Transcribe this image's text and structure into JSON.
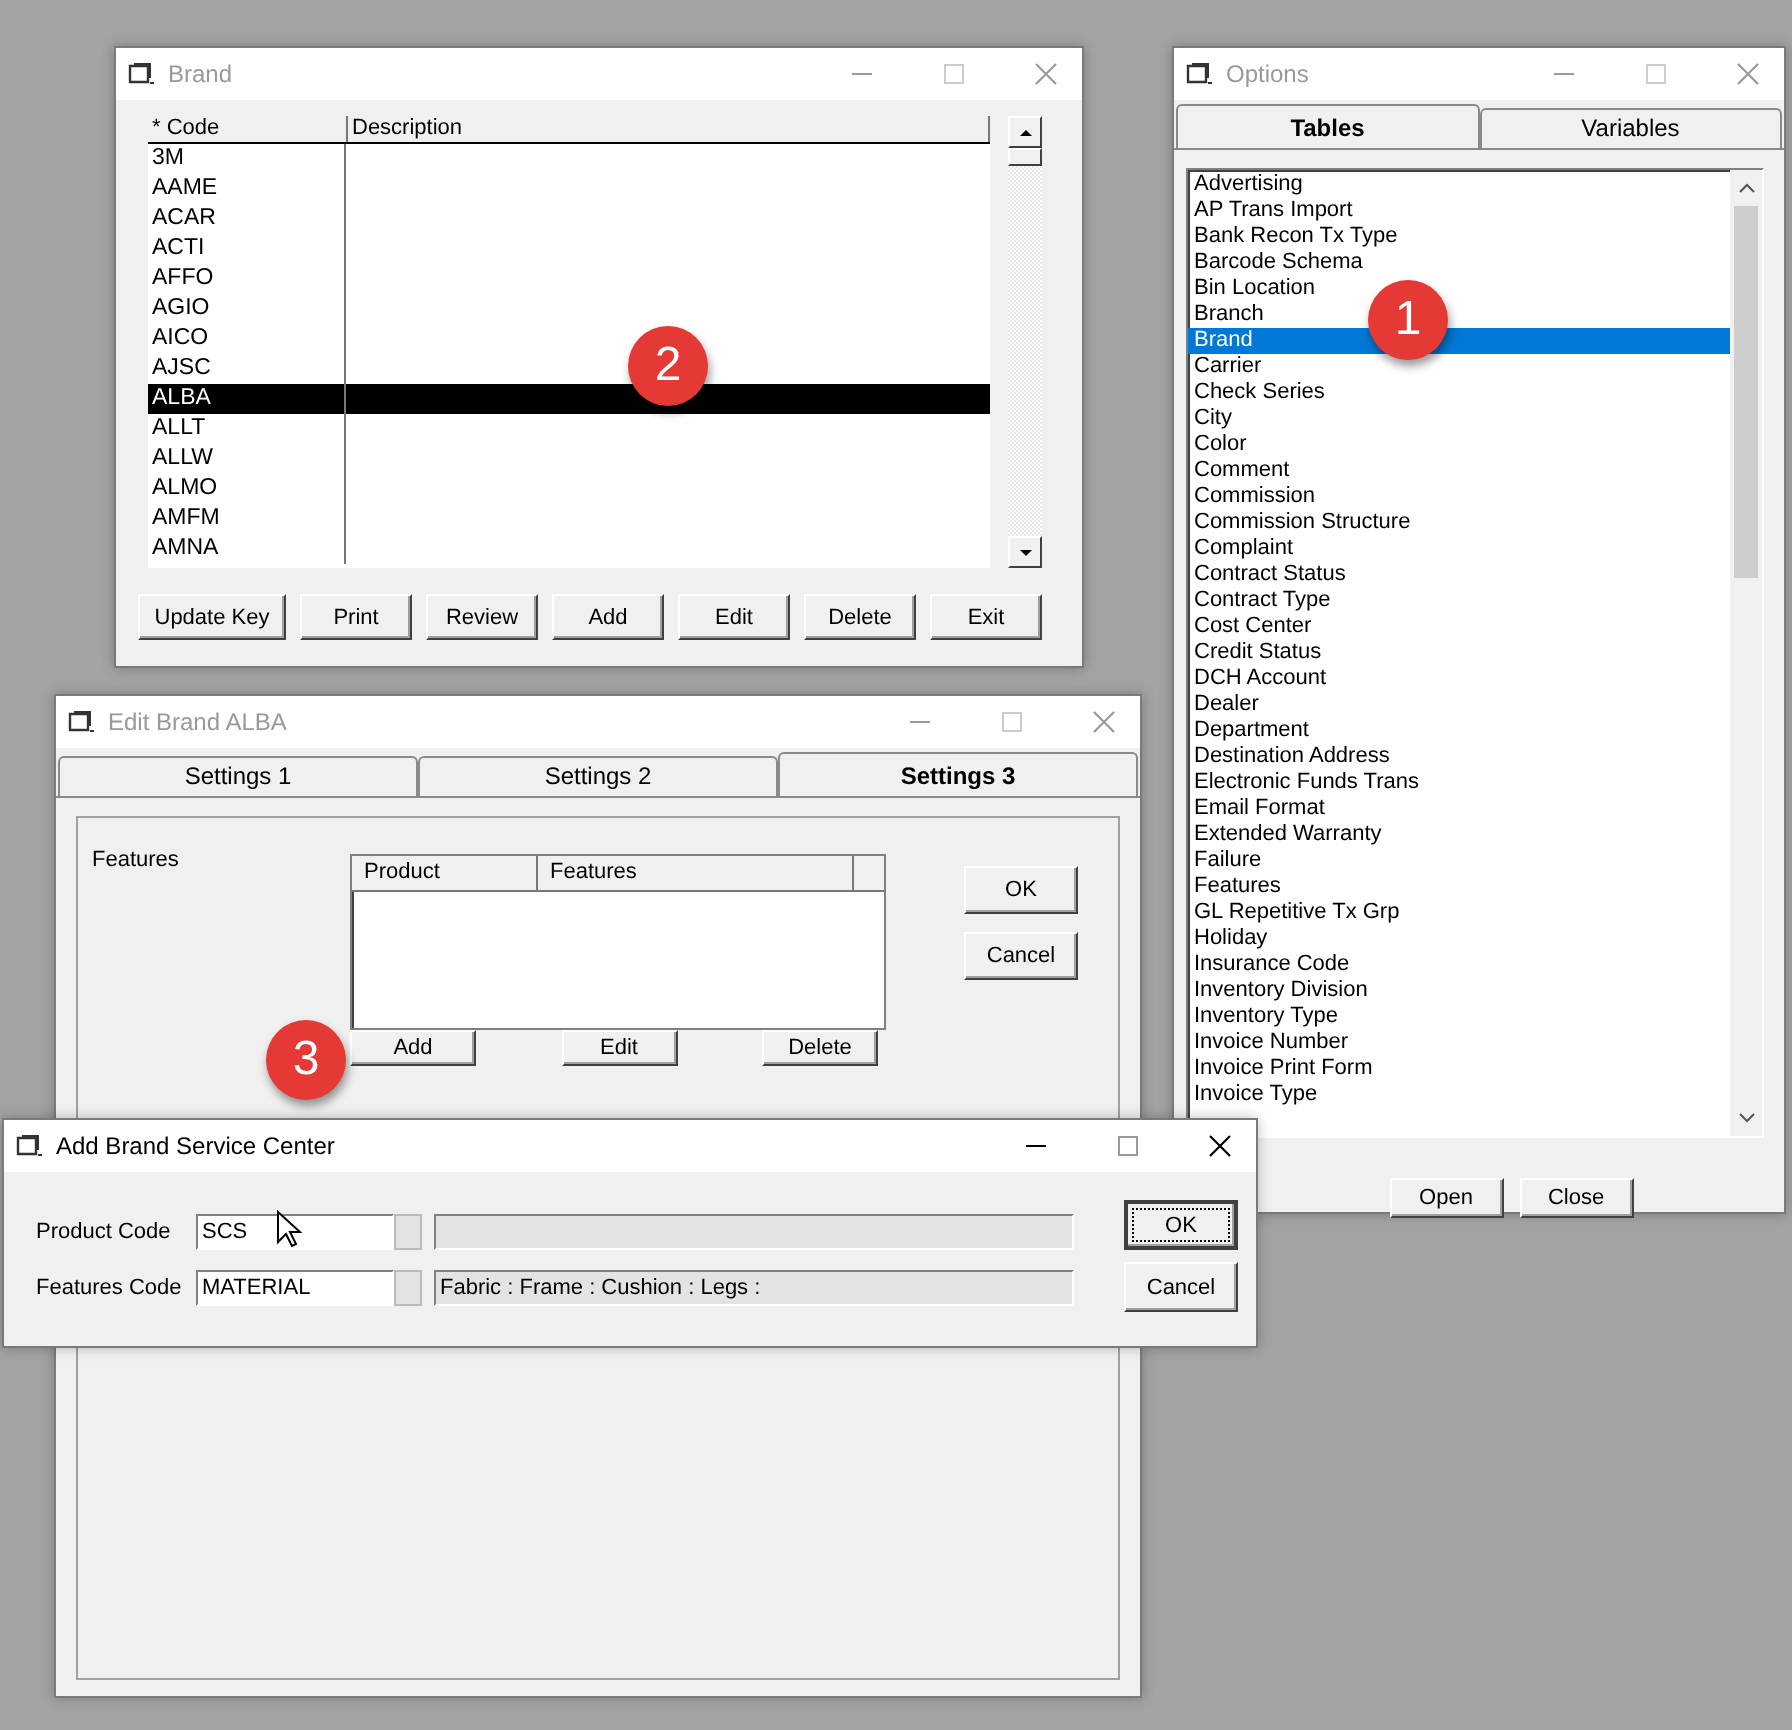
{
  "brand_window": {
    "title": "Brand",
    "active": false,
    "columns": [
      "* Code",
      "Description"
    ],
    "rows": [
      {
        "code": "3M",
        "selected": false
      },
      {
        "code": "AAME",
        "selected": false
      },
      {
        "code": "ACAR",
        "selected": false
      },
      {
        "code": "ACTI",
        "selected": false
      },
      {
        "code": "AFFO",
        "selected": false
      },
      {
        "code": "AGIO",
        "selected": false
      },
      {
        "code": "AICO",
        "selected": false
      },
      {
        "code": "AJSC",
        "selected": false
      },
      {
        "code": "ALBA",
        "selected": true
      },
      {
        "code": "ALLT",
        "selected": false
      },
      {
        "code": "ALLW",
        "selected": false
      },
      {
        "code": "ALMO",
        "selected": false
      },
      {
        "code": "AMFM",
        "selected": false
      },
      {
        "code": "AMNA",
        "selected": false
      }
    ],
    "buttons": [
      "Update Key",
      "Print",
      "Review",
      "Add",
      "Edit",
      "Delete",
      "Exit"
    ]
  },
  "options_window": {
    "title": "Options",
    "active": false,
    "tabs": [
      {
        "label": "Tables",
        "selected": true
      },
      {
        "label": "Variables",
        "selected": false
      }
    ],
    "items": [
      {
        "label": "Advertising",
        "selected": false
      },
      {
        "label": "AP Trans Import",
        "selected": false
      },
      {
        "label": "Bank Recon Tx Type",
        "selected": false
      },
      {
        "label": "Barcode Schema",
        "selected": false
      },
      {
        "label": "Bin Location",
        "selected": false
      },
      {
        "label": "Branch",
        "selected": false
      },
      {
        "label": "Brand",
        "selected": true
      },
      {
        "label": "Carrier",
        "selected": false
      },
      {
        "label": "Check Series",
        "selected": false
      },
      {
        "label": "City",
        "selected": false
      },
      {
        "label": "Color",
        "selected": false
      },
      {
        "label": "Comment",
        "selected": false
      },
      {
        "label": "Commission",
        "selected": false
      },
      {
        "label": "Commission Structure",
        "selected": false
      },
      {
        "label": "Complaint",
        "selected": false
      },
      {
        "label": "Contract Status",
        "selected": false
      },
      {
        "label": "Contract Type",
        "selected": false
      },
      {
        "label": "Cost Center",
        "selected": false
      },
      {
        "label": "Credit Status",
        "selected": false
      },
      {
        "label": "DCH Account",
        "selected": false
      },
      {
        "label": "Dealer",
        "selected": false
      },
      {
        "label": "Department",
        "selected": false
      },
      {
        "label": "Destination Address",
        "selected": false
      },
      {
        "label": "Electronic Funds Trans",
        "selected": false
      },
      {
        "label": "Email Format",
        "selected": false
      },
      {
        "label": "Extended Warranty",
        "selected": false
      },
      {
        "label": "Failure",
        "selected": false
      },
      {
        "label": "Features",
        "selected": false
      },
      {
        "label": "GL Repetitive Tx Grp",
        "selected": false
      },
      {
        "label": "Holiday",
        "selected": false
      },
      {
        "label": "Insurance Code",
        "selected": false
      },
      {
        "label": "Inventory Division",
        "selected": false
      },
      {
        "label": "Inventory Type",
        "selected": false
      },
      {
        "label": "Invoice Number",
        "selected": false
      },
      {
        "label": "Invoice Print Form",
        "selected": false
      },
      {
        "label": "Invoice Type",
        "selected": false
      }
    ],
    "buttons": [
      "Open",
      "Close"
    ]
  },
  "edit_brand_window": {
    "title": "Edit Brand ALBA",
    "active": false,
    "tabs": [
      {
        "label": "Settings 1",
        "selected": false
      },
      {
        "label": "Settings 2",
        "selected": false
      },
      {
        "label": "Settings 3",
        "selected": true
      }
    ],
    "section_label": "Features",
    "grid_columns": [
      "Product",
      "Features"
    ],
    "grid_buttons": [
      "Add",
      "Edit",
      "Delete"
    ],
    "buttons": [
      "OK",
      "Cancel"
    ]
  },
  "add_service_center_window": {
    "title": "Add Brand Service Center",
    "active": true,
    "fields": [
      {
        "label": "Product Code",
        "value": "SCS"
      },
      {
        "label": "Features Code",
        "value": "MATERIAL",
        "description": "Fabric : Frame : Cushion :  Legs :"
      }
    ],
    "buttons": [
      {
        "label": "OK",
        "default": true
      },
      {
        "label": "Cancel",
        "default": false
      }
    ]
  },
  "callouts": [
    {
      "number": "1",
      "kind": "options"
    },
    {
      "number": "2",
      "kind": "brand"
    },
    {
      "number": "3",
      "kind": "edit"
    }
  ]
}
